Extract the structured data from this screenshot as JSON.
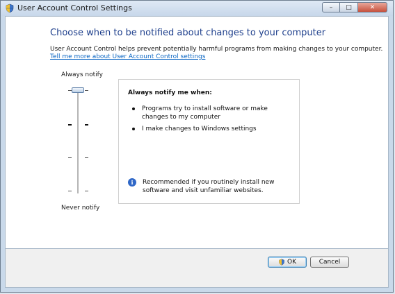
{
  "window": {
    "title": "User Account Control Settings",
    "icon": "uac-shield-icon"
  },
  "caption_buttons": {
    "minimize": "–",
    "maximize": "□",
    "close": "✕"
  },
  "main": {
    "heading": "Choose when to be notified about changes to your computer",
    "description": "User Account Control helps prevent potentially harmful programs from making changes to your computer.",
    "link": "Tell me more about User Account Control settings"
  },
  "slider": {
    "top_label": "Always notify",
    "bottom_label": "Never notify",
    "levels": 4,
    "selected_level": 4
  },
  "panel": {
    "title": "Always notify me when:",
    "bullets": [
      "Programs try to install software or make changes to my computer",
      "I make changes to Windows settings"
    ],
    "info_icon": "info-icon",
    "info_text": "Recommended if you routinely install new software and visit unfamiliar websites."
  },
  "buttons": {
    "ok": "OK",
    "cancel": "Cancel"
  },
  "colors": {
    "heading": "#1e3f8c",
    "link": "#0b66c3",
    "info": "#2f67c7"
  }
}
